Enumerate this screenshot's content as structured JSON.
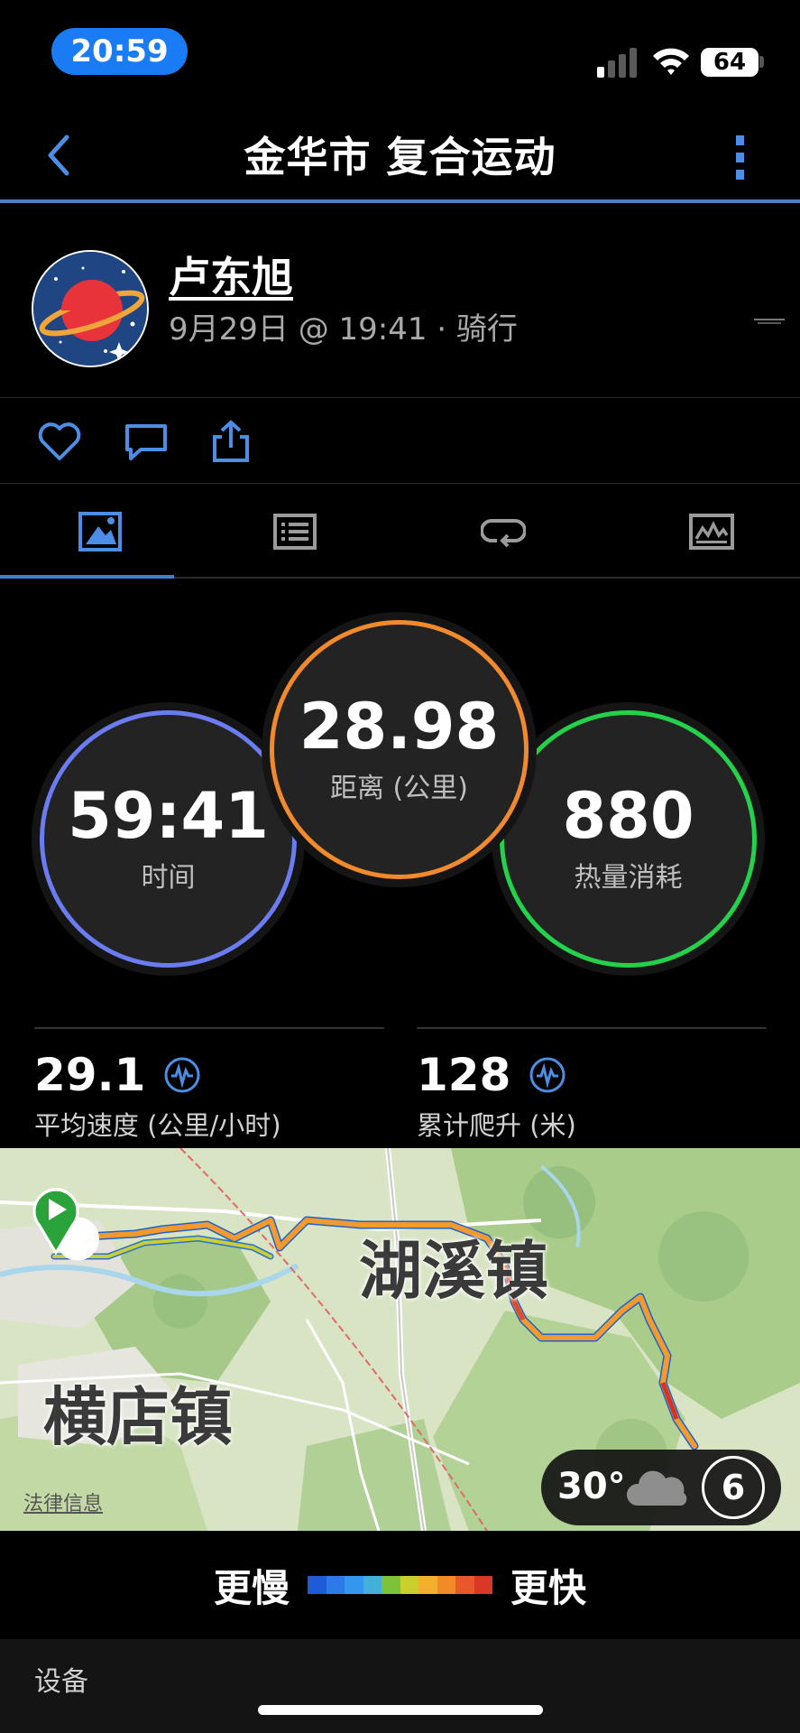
{
  "status_bar": {
    "time": "20:59",
    "battery": "64"
  },
  "nav": {
    "title": "金华市 复合运动"
  },
  "user": {
    "name": "卢东旭",
    "meta": "9月29日 @ 19:41 · 骑行"
  },
  "actions": [
    "heart-icon",
    "comment-icon",
    "share-icon"
  ],
  "tabs": [
    "overview-icon",
    "list-icon",
    "laps-icon",
    "chart-icon"
  ],
  "metrics": {
    "time": {
      "value": "59:41",
      "label": "时间",
      "color": "#6a7cf0"
    },
    "distance": {
      "value": "28.98",
      "label": "距离 (公里)",
      "color": "#f08a2c"
    },
    "calories": {
      "value": "880",
      "label": "热量消耗",
      "color": "#23d14a"
    }
  },
  "stats": {
    "avg_speed": {
      "value": "29.1",
      "label": "平均速度 (公里/小时)"
    },
    "elevation": {
      "value": "128",
      "label": "累计爬升 (米)"
    }
  },
  "map": {
    "place_1": "湖溪镇",
    "place_2": "横店镇",
    "legal": "法律信息",
    "weather_temp": "30°",
    "wind": "6"
  },
  "legend": {
    "slower": "更慢",
    "faster": "更快",
    "colors": [
      "#1e5bd6",
      "#2e79e8",
      "#3596ef",
      "#43b0d9",
      "#7cc23a",
      "#c9cf2b",
      "#f2b02d",
      "#f28a28",
      "#e8582a",
      "#d93826"
    ]
  },
  "device": {
    "title": "设备"
  }
}
